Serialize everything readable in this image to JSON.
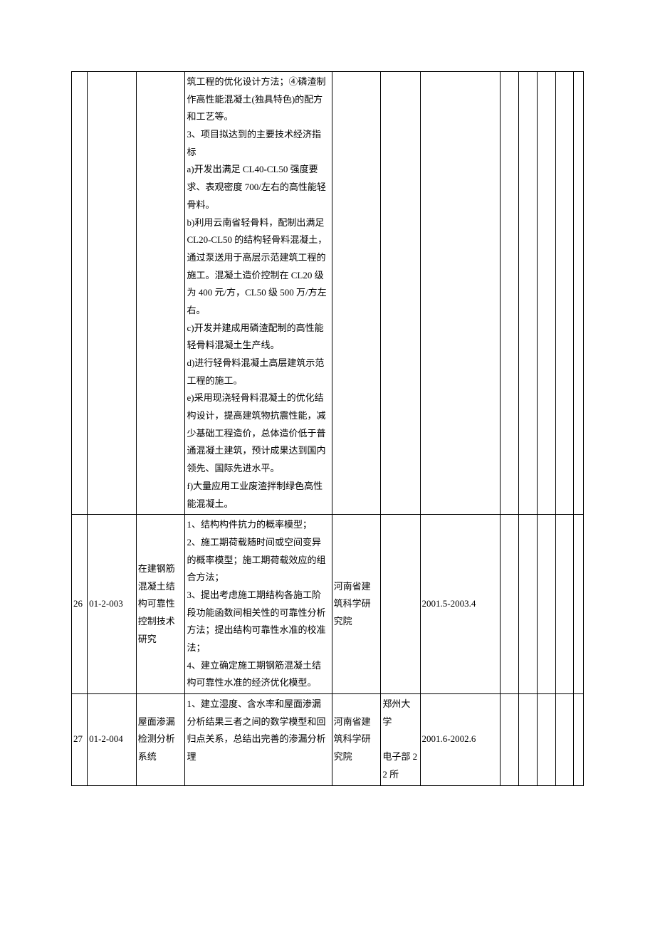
{
  "rows": [
    {
      "idx": "",
      "code": "",
      "title": "",
      "body": "筑工程的优化设计方法；④磷渣制作高性能混凝土(独具特色)的配方和工艺等。\n3、项目拟达到的主要技术经济指标\na)开发出满足 CL40-CL50 强度要求、表观密度 700/左右的高性能轻骨料。\nb)利用云南省轻骨料，配制出满足 CL20-CL50 的结构轻骨料混凝土，通过泵送用于高层示范建筑工程的施工。混凝土造价控制在 CL20 级为 400 元/方，CL50 级 500 万/方左右。\nc)开发并建成用磷渣配制的高性能轻骨料混凝土生产线。\nd)进行轻骨料混凝土高层建筑示范工程的施工。\ne)采用现浇轻骨料混凝土的优化结构设计，提高建筑物抗震性能，减少基础工程造价，总体造价低于普通混凝土建筑，预计成果达到国内领先、国际先进水平。\nf)大量应用工业废渣拌制绿色高性能混凝土。",
      "org": "",
      "coop": "",
      "date": "",
      "e1": "",
      "e2": "",
      "e3": "",
      "e4": "",
      "e5": ""
    },
    {
      "idx": "26",
      "code": "01-2-003",
      "title": "在建钢筋混凝土结构可靠性控制技术研究",
      "body": "1、结构构件抗力的概率模型；\n2、施工期荷载随时间或空间变异的概率模型；施工期荷载效应的组合方法；\n3、提出考虑施工期结构各施工阶段功能函数间相关性的可靠性分析方法；提出结构可靠性水准的校准法；\n4、建立确定施工期钢筋混凝土结构可靠性水准的经济优化模型。",
      "org": "河南省建筑科学研究院",
      "coop": "",
      "date": "2001.5-2003.4",
      "e1": "",
      "e2": "",
      "e3": "",
      "e4": "",
      "e5": ""
    },
    {
      "idx": "27",
      "code": "01-2-004",
      "title": "屋面渗漏检测分析系统",
      "body": "1、建立湿度、含水率和屋面渗漏分析结果三者之间的数学模型和回归点关系，总结出完善的渗漏分析理",
      "org": "河南省建筑科学研究院",
      "coop": "郑州大学\n\n电子部 22 所",
      "date": "2001.6-2002.6",
      "e1": "",
      "e2": "",
      "e3": "",
      "e4": "",
      "e5": ""
    }
  ]
}
